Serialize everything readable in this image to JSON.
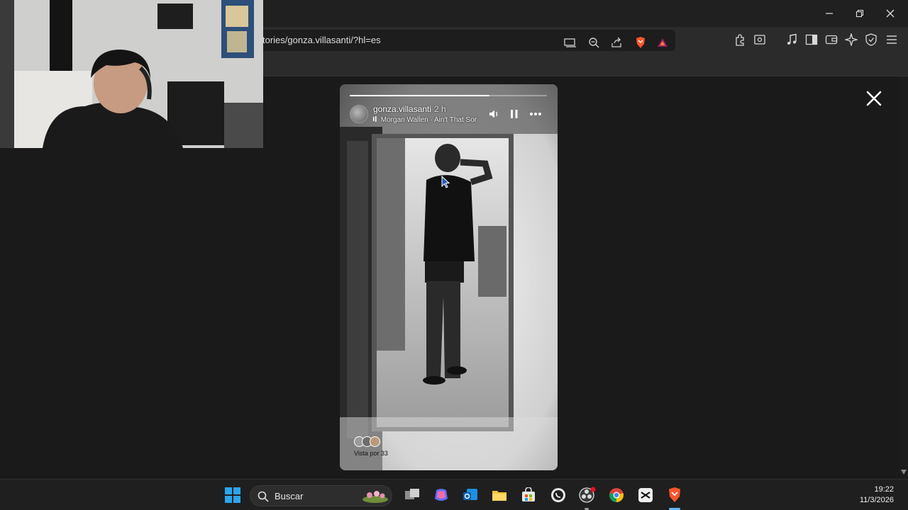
{
  "browser": {
    "url": "tories/gonza.villasanti/?hl=es"
  },
  "story": {
    "username": "gonza.villasanti",
    "time_ago": "2 h",
    "music_label": "Morgan Wallen · Ain't That Sor",
    "progress": 0.71,
    "viewed_by": "Vista por 33"
  },
  "taskbar": {
    "search_label": "Buscar",
    "time": "19:22",
    "date": "11/3/2026"
  },
  "colors": {
    "brave": "#fb542b",
    "background": "#1a1a1a"
  }
}
